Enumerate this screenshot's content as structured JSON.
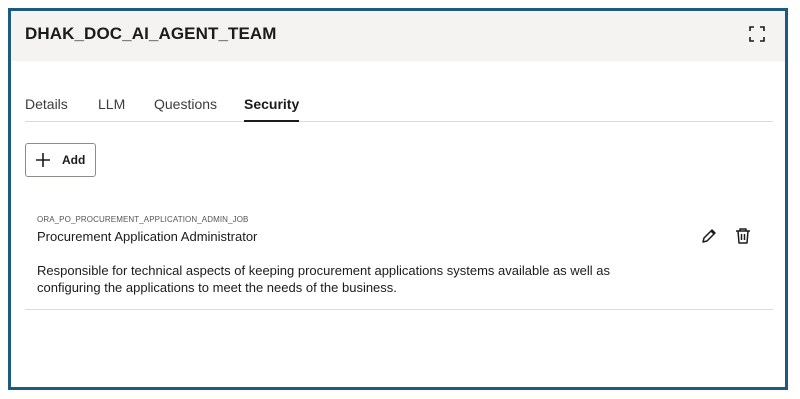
{
  "panel": {
    "title": "DHAK_DOC_AI_AGENT_TEAM",
    "expand_icon": "expand-icon"
  },
  "tabs": [
    {
      "label": "Details",
      "active": false
    },
    {
      "label": "LLM",
      "active": false
    },
    {
      "label": "Questions",
      "active": false
    },
    {
      "label": "Security",
      "active": true
    }
  ],
  "toolbar": {
    "add_label": "Add",
    "add_icon": "plus-icon"
  },
  "security_items": [
    {
      "code": "ORA_PO_PROCUREMENT_APPLICATION_ADMIN_JOB",
      "title": "Procurement Application Administrator",
      "description": "Responsible for technical aspects of keeping procurement applications systems available as well as configuring the applications to meet the needs of the business.",
      "edit_icon": "pencil-icon",
      "delete_icon": "trash-icon"
    }
  ],
  "colors": {
    "frame_border": "#1e5a7e",
    "header_bg": "#f4f3f1"
  }
}
